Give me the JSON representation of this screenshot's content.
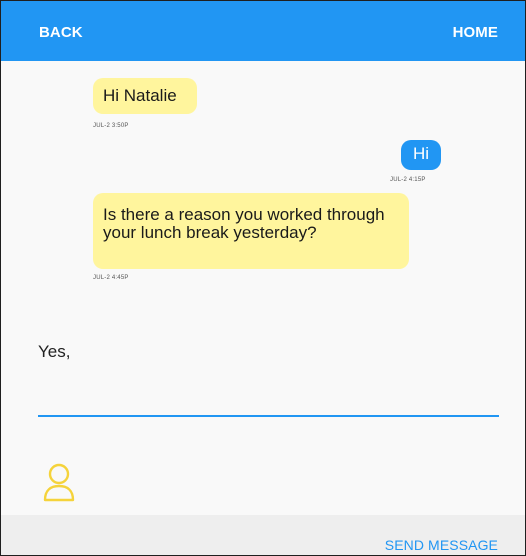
{
  "app": {
    "back_label": "BACK",
    "home_label": "HOME"
  },
  "messages": [
    {
      "side": "left",
      "text": "Hi Natalie",
      "timestamp": "JUL-2 3:50P"
    },
    {
      "side": "right",
      "text": "Hi",
      "timestamp": "JUL-2 4:15P"
    },
    {
      "side": "left",
      "text": "Is there a reason you worked through your lunch break yesterday?",
      "timestamp": "JUL-2 4:45P"
    }
  ],
  "composer": {
    "value": "Yes,"
  },
  "footer": {
    "send_label": "SEND MESSAGE"
  },
  "icons": {
    "avatar": "user-icon"
  },
  "colors": {
    "primary": "#2196f3",
    "incoming_bubble": "#fff59d",
    "avatar_outline": "#f5d33b"
  }
}
